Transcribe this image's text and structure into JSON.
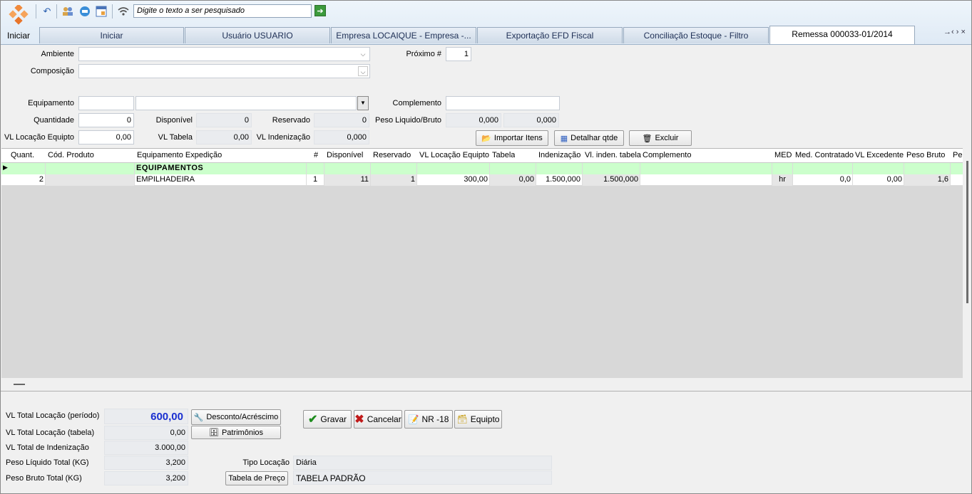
{
  "toolbar": {
    "home_label": "Iniciar",
    "search_placeholder": "Digite o texto a ser pesquisado"
  },
  "tabs": [
    {
      "label": "Iniciar"
    },
    {
      "label": "Usuário USUARIO"
    },
    {
      "label": "Empresa LOCAIQUE - Empresa -..."
    },
    {
      "label": "Exportação EFD Fiscal"
    },
    {
      "label": "Conciliação Estoque - Filtro"
    },
    {
      "label": "Remessa 000033-01/2014",
      "active": true
    }
  ],
  "nav_arrows": "→‹ › ×",
  "form": {
    "ambiente_label": "Ambiente",
    "ambiente_value": "",
    "composicao_label": "Composição",
    "composicao_value": "",
    "proximo_label": "Próximo #",
    "proximo_value": "1",
    "equipamento_label": "Equipamento",
    "equipamento_code": "",
    "equipamento_desc": "",
    "complemento_label": "Complemento",
    "complemento_value": "",
    "quantidade_label": "Quantidade",
    "quantidade_value": "0",
    "disponivel_label": "Disponível",
    "disponivel_value": "0",
    "reservado_label": "Reservado",
    "reservado_value": "0",
    "peso_label": "Peso Liquido/Bruto",
    "peso_liquido": "0,000",
    "peso_bruto": "0,000",
    "vl_locacao_label": "VL Locação Equipto",
    "vl_locacao_value": "0,00",
    "vl_tabela_label": "VL Tabela",
    "vl_tabela_value": "0,00",
    "vl_indenizacao_label": "VL Indenização",
    "vl_indenizacao_value": "0,000",
    "importar_label": "Importar Itens",
    "detalhar_label": "Detalhar qtde",
    "excluir_label": "Excluir"
  },
  "grid": {
    "headers": [
      "Quant.",
      "Cód. Produto",
      "Equipamento Expedição",
      "#",
      "Disponível",
      "Reservado",
      "VL Locação Equipto",
      "Tabela",
      "Indenização",
      "Vl. inden. tabela",
      "Complemento",
      "MED",
      "Med. Contratado",
      "VL Excedente",
      "Peso Bruto",
      "Pe"
    ],
    "group_label": "EQUIPAMENTOS",
    "row": {
      "quant": "2",
      "cod": "",
      "equip": "EMPILHADEIRA",
      "num": "1",
      "disp": "11",
      "res": "1",
      "vl_loc": "300,00",
      "tabela": "0,00",
      "inden": "1.500,000",
      "vl_inden": "1.500,000",
      "compl": "",
      "med": "hr",
      "med_contr": "0,0",
      "vl_exc": "0,00",
      "peso_bruto": "1,6"
    }
  },
  "totals": {
    "vl_total_periodo_label": "VL Total Locação (período)",
    "vl_total_periodo_value": "600,00",
    "vl_total_tabela_label": "VL Total Locação (tabela)",
    "vl_total_tabela_value": "0,00",
    "vl_total_inden_label": "VL Total de Indenização",
    "vl_total_inden_value": "3.000,00",
    "peso_liq_label": "Peso Líquido Total (KG)",
    "peso_liq_value": "3,200",
    "peso_bruto_label": "Peso Bruto Total (KG)",
    "peso_bruto_value": "3,200",
    "desconto_label": "Desconto/Acréscimo",
    "patrimonios_label": "Patrimônios",
    "gravar_label": "Gravar",
    "cancelar_label": "Cancelar",
    "nr18_label": "NR -18",
    "equipto_label": "Equipto",
    "tipo_locacao_label": "Tipo Locação",
    "tipo_locacao_value": "Diária",
    "tabela_preco_label": "Tabela de Preço",
    "tabela_preco_value": "TABELA PADRÃO"
  },
  "colors": {
    "accent_total": "#1a2fd0",
    "group_row": "#ccffcc"
  }
}
